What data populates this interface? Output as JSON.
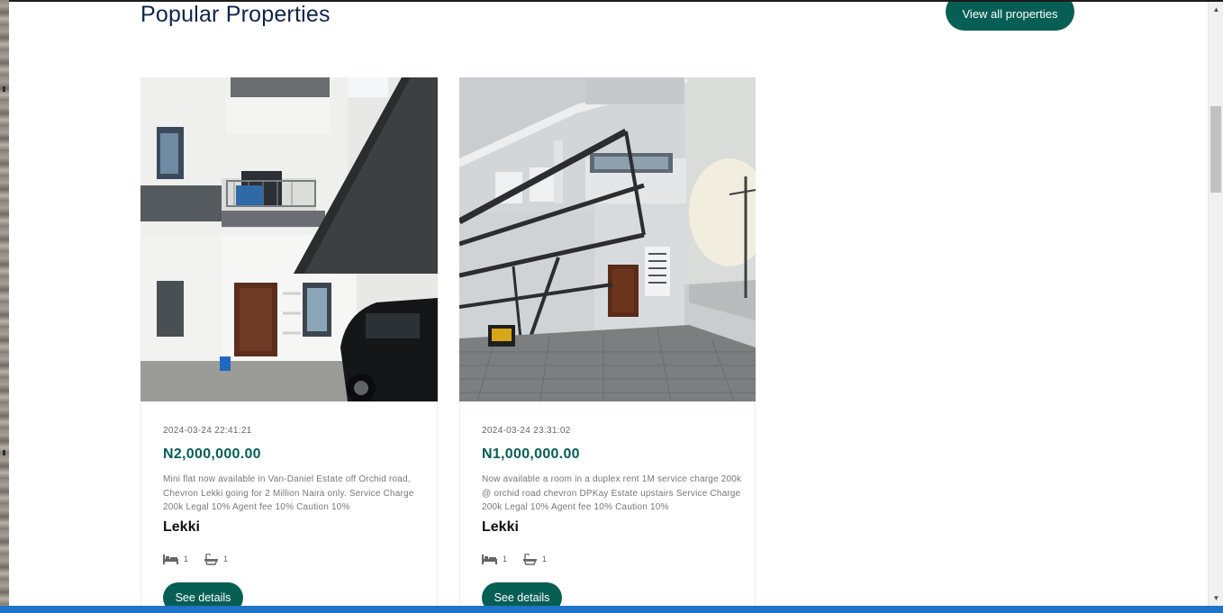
{
  "page": {
    "section_title": "Popular Properties",
    "view_all_label": "View all properties"
  },
  "properties": [
    {
      "date": "2024-03-24 22:41:21",
      "price": "N2,000,000.00",
      "description": "Mini flat now available in Van-Daniel Estate off Orchid road, Chevron Lekki going for 2 Million Naira only. Service Charge 200k Legal 10% Agent fee 10% Caution 10%",
      "location": "Lekki",
      "beds": "1",
      "baths": "1",
      "button_label": "See details"
    },
    {
      "date": "2024-03-24 23:31:02",
      "price": "N1,000,000.00",
      "description": "Now available a room in a duplex rent 1M service charge 200k @ orchid road chevron DPKay Estate upstairs Service Charge 200k Legal 10% Agent fee 10% Caution 10%",
      "location": "Lekki",
      "beds": "1",
      "baths": "1",
      "button_label": "See details"
    }
  ],
  "icons": {
    "bed": "bed-icon",
    "bath": "bathtub-icon",
    "scroll_up": "scroll-up-arrow-icon",
    "scroll_down": "scroll-down-arrow-icon"
  },
  "colors": {
    "accent": "#075e54",
    "title": "#10254a",
    "text_muted": "#777777"
  }
}
